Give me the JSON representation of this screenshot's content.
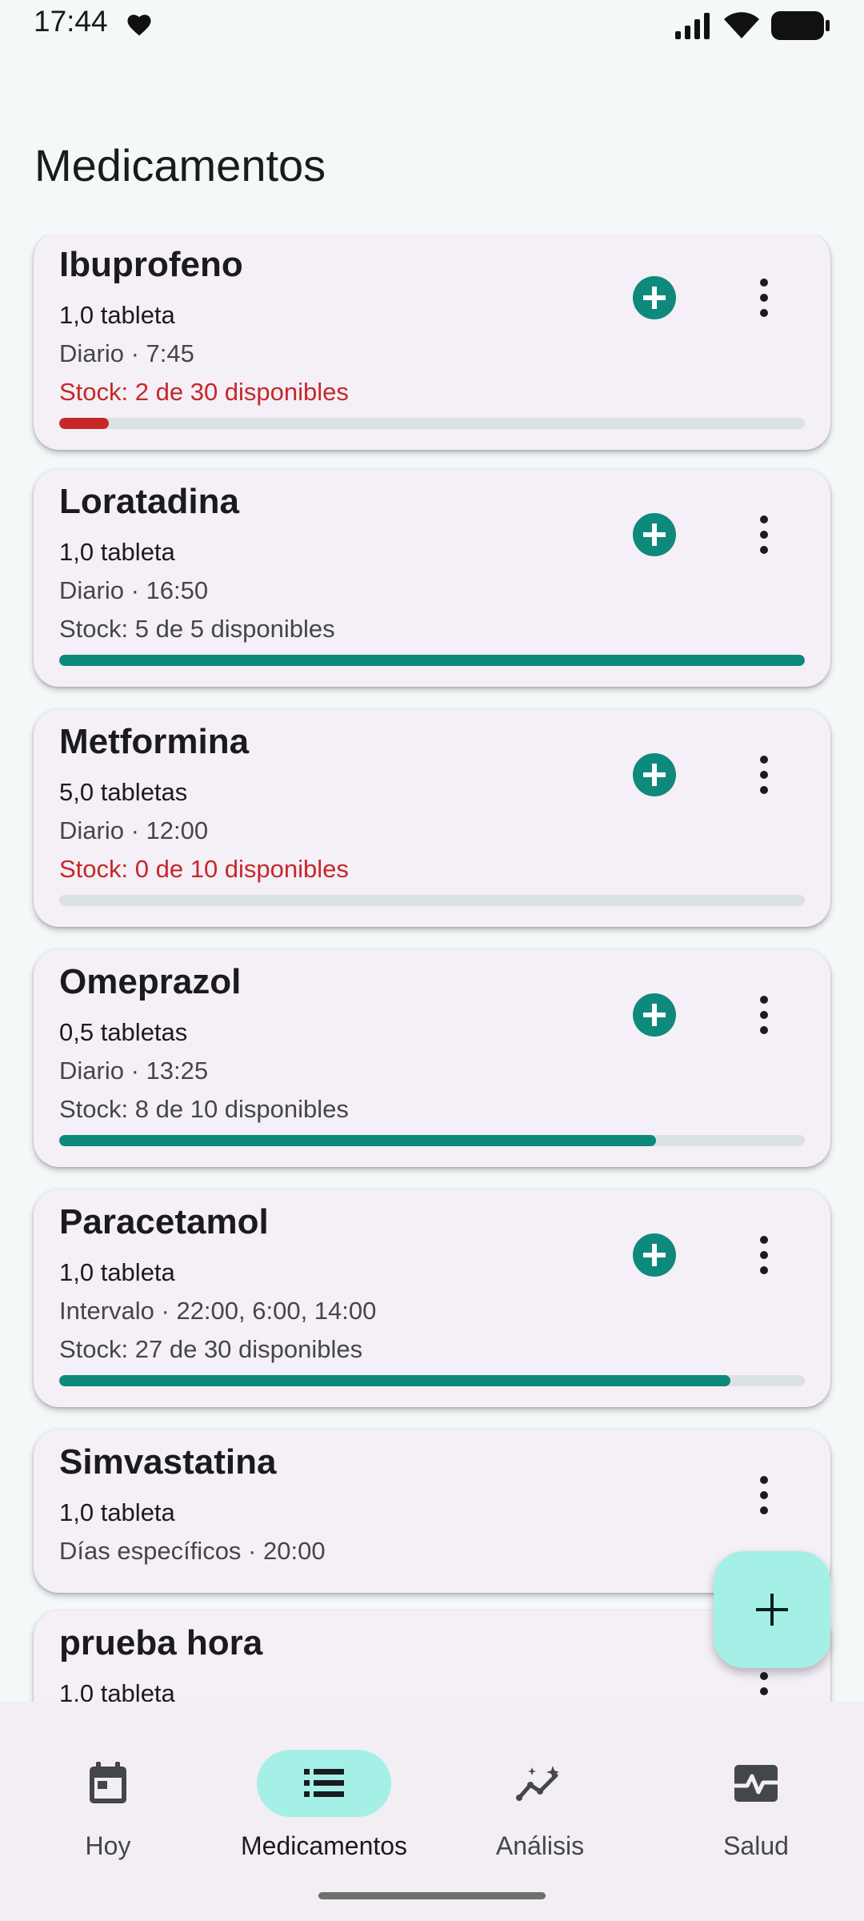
{
  "status": {
    "time": "17:44"
  },
  "title": "Medicamentos",
  "medications": [
    {
      "name": "Ibuprofeno",
      "dose": "1,0 tableta",
      "schedule": "Diario · 7:45",
      "stock_text": "Stock: 2 de 30 disponibles",
      "stock_fraction": 0.0667,
      "low": true,
      "has_add": true
    },
    {
      "name": "Loratadina",
      "dose": "1,0 tableta",
      "schedule": "Diario · 16:50",
      "stock_text": "Stock: 5 de 5 disponibles",
      "stock_fraction": 1.0,
      "low": false,
      "has_add": true
    },
    {
      "name": "Metformina",
      "dose": "5,0 tabletas",
      "schedule": "Diario · 12:00",
      "stock_text": "Stock: 0 de 10 disponibles",
      "stock_fraction": 0.0,
      "low": true,
      "has_add": true
    },
    {
      "name": "Omeprazol",
      "dose": "0,5 tabletas",
      "schedule": "Diario · 13:25",
      "stock_text": "Stock: 8 de 10 disponibles",
      "stock_fraction": 0.8,
      "low": false,
      "has_add": true
    },
    {
      "name": "Paracetamol",
      "dose": "1,0 tableta",
      "schedule": "Intervalo · 22:00, 6:00, 14:00",
      "stock_text": "Stock: 27 de 30 disponibles",
      "stock_fraction": 0.9,
      "low": false,
      "has_add": true
    },
    {
      "name": "Simvastatina",
      "dose": "1,0 tableta",
      "schedule": "Días específicos · 20:00",
      "has_add": false
    },
    {
      "name": "prueba hora",
      "dose": "1,0 tableta",
      "has_add": false
    }
  ],
  "nav": [
    {
      "label": "Hoy",
      "icon": "calendar-icon",
      "active": false
    },
    {
      "label": "Medicamentos",
      "icon": "list-icon",
      "active": true
    },
    {
      "label": "Análisis",
      "icon": "analytics-icon",
      "active": false
    },
    {
      "label": "Salud",
      "icon": "health-monitor-icon",
      "active": false
    }
  ],
  "colors": {
    "accent": "#0d8a7c",
    "low_stock": "#c62828",
    "fab": "#a5f0e6",
    "card": "#f5eff7"
  }
}
